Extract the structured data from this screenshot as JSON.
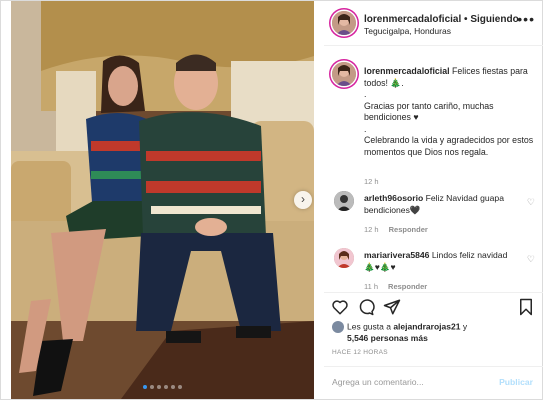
{
  "header": {
    "username": "lorenmercadaloficial",
    "separator": "•",
    "follow_status": "Siguiendo",
    "location": "Tegucigalpa, Honduras",
    "more_icon": "more-horizontal-icon"
  },
  "caption": {
    "username": "lorenmercadaloficial",
    "text": "Felices fiestas para todos! 🎄.\n.\nGracias por tanto cariño, muchas bendiciones ♥\n.\nCelebrando la vida y agradecidos por estos momentos que Dios nos regala.",
    "time": "12 h"
  },
  "comments": [
    {
      "username": "arleth96osorio",
      "text": "Feliz Navidad guapa bendiciones🖤",
      "time": "12 h",
      "reply_label": "Responder"
    },
    {
      "username": "mariarivera5846",
      "text": "Lindos feliz navidad🎄♥🎄♥",
      "time": "11 h",
      "reply_label": "Responder"
    }
  ],
  "likes": {
    "prefix": "Les gusta a",
    "user": "alejandrarojas21",
    "conj": "y",
    "rest": "5,546 personas más"
  },
  "time_ago": "HACE 12 HORAS",
  "add_comment": {
    "placeholder": "Agrega un comentario...",
    "post_label": "Publicar"
  },
  "carousel": {
    "total": 6,
    "active_index": 0
  },
  "colors": {
    "accent": "#3897f0",
    "ring": "#d6249f",
    "post_disabled": "#b2dffc",
    "meta": "#8e8e8e"
  },
  "icons": [
    "heart-icon",
    "comment-icon",
    "share-icon",
    "bookmark-icon",
    "chevron-right-icon"
  ]
}
